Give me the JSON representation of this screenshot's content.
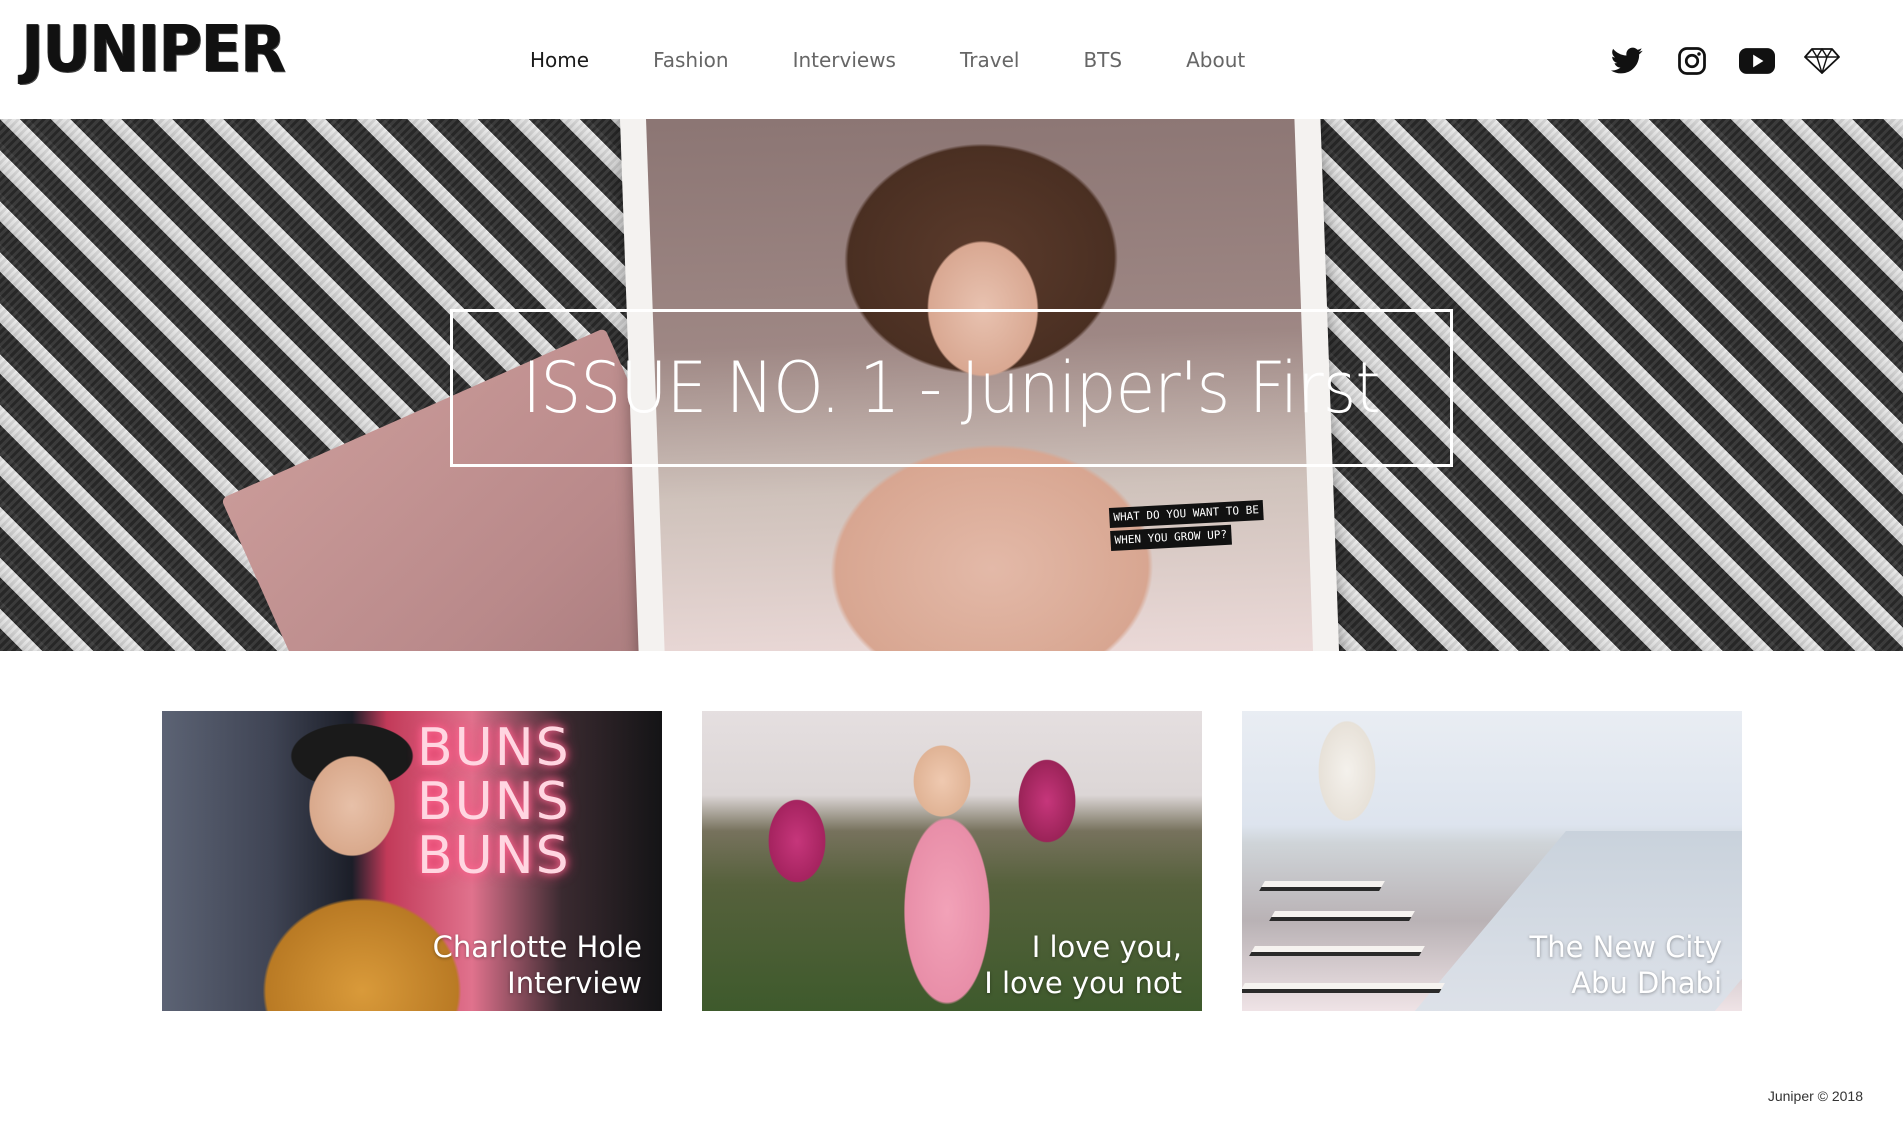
{
  "header": {
    "logo": "JUNIPER",
    "nav": [
      {
        "label": "Home",
        "active": true
      },
      {
        "label": "Fashion",
        "active": false
      },
      {
        "label": "Interviews",
        "active": false
      },
      {
        "label": "Travel",
        "active": false
      },
      {
        "label": "BTS",
        "active": false
      },
      {
        "label": "About",
        "active": false
      }
    ],
    "social": [
      {
        "icon": "twitter-icon"
      },
      {
        "icon": "instagram-icon"
      },
      {
        "icon": "youtube-icon"
      },
      {
        "icon": "diamond-icon"
      }
    ]
  },
  "hero": {
    "title": "ISSUE NO. 1 - Juniper's First",
    "magazine_caption_line1": "WHAT DO YOU WANT TO BE",
    "magazine_caption_line2": "WHEN YOU GROW UP?"
  },
  "cards": [
    {
      "line1": "Charlotte Hole",
      "line2": "Interview",
      "neon": "BUNS\nBUNS\nBUNS"
    },
    {
      "line1": "I love you,",
      "line2": "I love you not"
    },
    {
      "line1": "The New City",
      "line2": "Abu Dhabi"
    }
  ],
  "footer": {
    "copyright": "Juniper © 2018"
  },
  "colors": {
    "text_dark": "#1a1a1a",
    "nav_inactive": "#666666",
    "hero_border": "#ffffff"
  }
}
